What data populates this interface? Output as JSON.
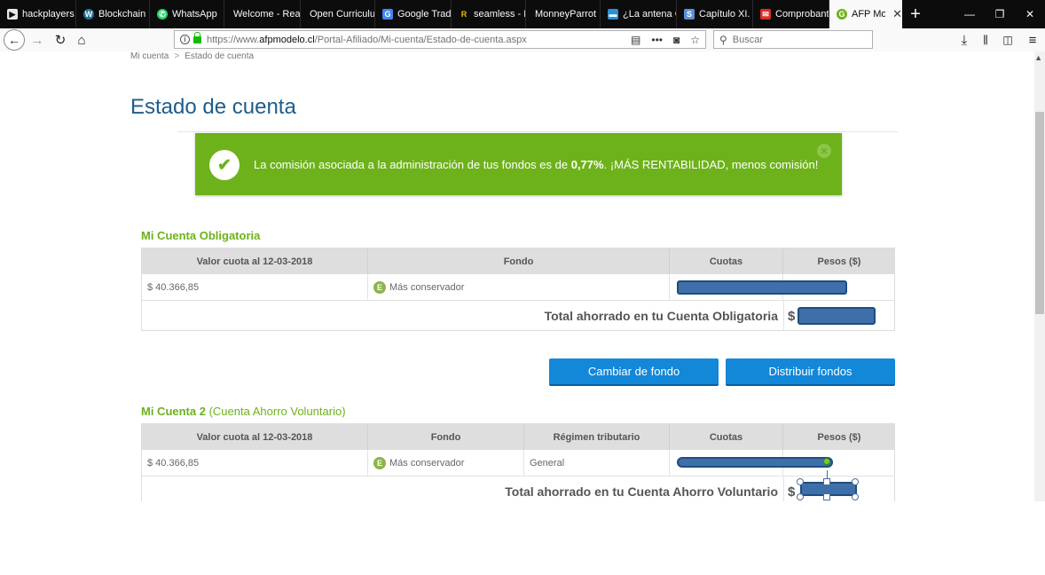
{
  "tabs": [
    {
      "label": "hackplayers",
      "icon": "video-icon",
      "color": "#e8e8e8"
    },
    {
      "label": "Blockchain F",
      "icon": "wordpress-icon",
      "color": "#21759b"
    },
    {
      "label": "WhatsApp",
      "icon": "whatsapp-icon",
      "color": "#25d366"
    },
    {
      "label": "Welcome - Reali",
      "icon": "",
      "color": ""
    },
    {
      "label": "Open Curriculum",
      "icon": "",
      "color": ""
    },
    {
      "label": "Google Trad",
      "icon": "translate-icon",
      "color": "#4285f4"
    },
    {
      "label": "seamless - Ei",
      "icon": "r-icon",
      "color": "#ffb400"
    },
    {
      "label": "MonneyParrot",
      "icon": "",
      "color": ""
    },
    {
      "label": "¿La antena C",
      "icon": "chat-icon",
      "color": "#2a8fd6"
    },
    {
      "label": "Capítulo XI.",
      "icon": "image-icon",
      "color": "#5b8fd4"
    },
    {
      "label": "Comprobant",
      "icon": "mail-icon",
      "color": "#d93025"
    },
    {
      "label": "AFP Model",
      "icon": "afp-icon",
      "color": "#6db21a",
      "active": true
    }
  ],
  "tab_close_glyph": "✕",
  "new_tab_glyph": "+",
  "window_controls": {
    "minimize": "—",
    "restore": "❐",
    "close": "✕"
  },
  "nav": {
    "url_prefix": "https://www.",
    "url_domain": "afpmodelo.cl",
    "url_path": "/Portal-Afiliado/Mi-cuenta/Estado-de-cuenta.aspx",
    "search_placeholder": "Buscar",
    "menu_dots": "•••"
  },
  "breadcrumb": {
    "home": "Mi cuenta",
    "separator": ">",
    "current": "Estado de cuenta"
  },
  "page_title": "Estado de cuenta",
  "banner": {
    "text_before": "La comisión asociada a la administración de tus fondos es de ",
    "rate": "0,77%",
    "text_after": ". ¡MÁS RENTABILIDAD, menos comisión!",
    "close_glyph": "✕"
  },
  "account1": {
    "title": "Mi Cuenta Obligatoria",
    "headers": {
      "valor": "Valor cuota al 12-03-2018",
      "fondo": "Fondo",
      "cuotas": "Cuotas",
      "pesos": "Pesos ($)"
    },
    "row": {
      "valor": "$ 40.366,85",
      "badge": "E",
      "fondo": "Más conservador"
    },
    "total_label": "Total ahorrado en tu Cuenta Obligatoria",
    "currency": "$"
  },
  "buttons": {
    "change_fund": "Cambiar de fondo",
    "distribute_funds": "Distribuir fondos"
  },
  "account2": {
    "title": "Mi Cuenta 2",
    "subtitle": "(Cuenta Ahorro Voluntario)",
    "headers": {
      "valor": "Valor cuota al 12-03-2018",
      "fondo": "Fondo",
      "regimen": "Régimen tributario",
      "cuotas": "Cuotas",
      "pesos": "Pesos ($)"
    },
    "row": {
      "valor": "$ 40.366,85",
      "badge": "E",
      "fondo": "Más conservador",
      "regimen": "General"
    },
    "total_label": "Total ahorrado en tu Cuenta Ahorro Voluntario",
    "currency": "$"
  },
  "colors": {
    "accent_green": "#6db21a",
    "title_blue": "#1d5d8c",
    "button_blue": "#1387d8",
    "redaction": "#3e6fa8"
  }
}
